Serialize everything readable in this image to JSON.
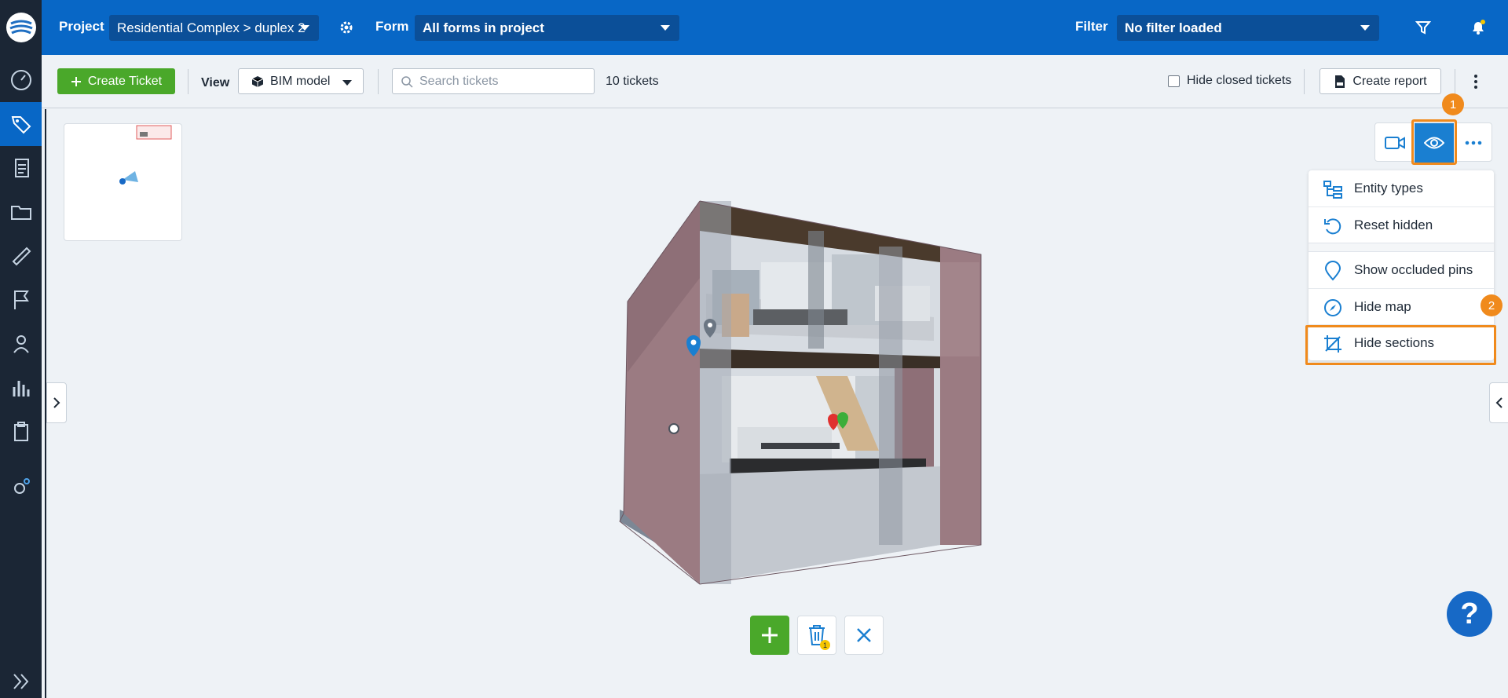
{
  "topbar": {
    "project_label": "Project",
    "project_value": "Residential Complex > duplex 2",
    "form_label": "Form",
    "form_value": "All forms in project",
    "filter_label": "Filter",
    "filter_value": "No filter loaded"
  },
  "toolbar": {
    "create_ticket": "Create Ticket",
    "view_label": "View",
    "view_value": "BIM model",
    "search_placeholder": "Search tickets",
    "ticket_count": "10 tickets",
    "hide_closed": "Hide closed tickets",
    "create_report": "Create report"
  },
  "menu": {
    "items": [
      "Entity types",
      "Reset hidden",
      "Show occluded pins",
      "Hide map",
      "Hide sections"
    ]
  },
  "badges": {
    "step1": "1",
    "step2": "2"
  },
  "bottom": {
    "delete_count": "1"
  },
  "help": "?",
  "colors": {
    "primary": "#0867c6",
    "sidebar": "#1b2635",
    "green": "#4aa82a",
    "highlight": "#f08a1c"
  }
}
